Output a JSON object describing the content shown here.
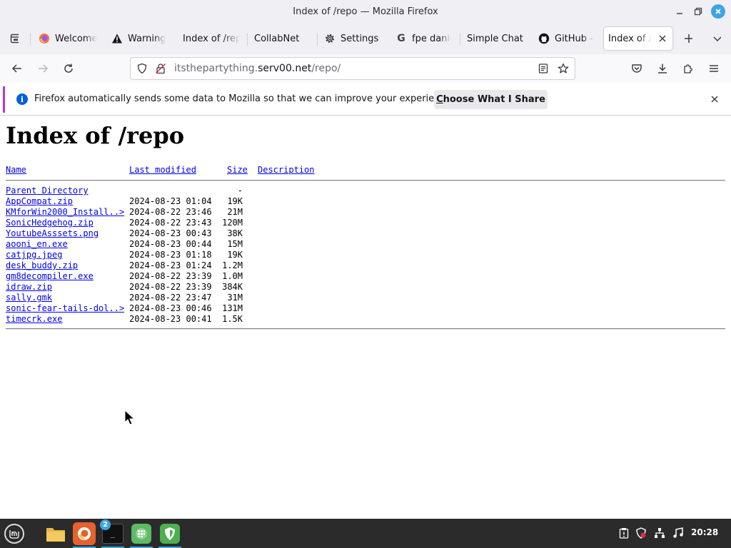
{
  "window": {
    "title": "Index of /repo — Mozilla Firefox"
  },
  "tabs": [
    {
      "label": "Welcome",
      "icon": "firefox-icon"
    },
    {
      "label": "Warning:",
      "icon": "warning-icon"
    },
    {
      "label": "Index of /rep",
      "icon": ""
    },
    {
      "label": "CollabNet",
      "icon": ""
    },
    {
      "label": "Settings",
      "icon": "gear-icon"
    },
    {
      "label": "fpe danie",
      "icon": "google-icon"
    },
    {
      "label": "Simple Chat",
      "icon": ""
    },
    {
      "label": "GitHub - y",
      "icon": "github-icon"
    },
    {
      "label": "Index of /r",
      "icon": "",
      "active": true
    }
  ],
  "navbar": {
    "url_prefix": "itsthepartything.",
    "url_host": "serv00.net",
    "url_path": "/repo/"
  },
  "notification": {
    "message": "Firefox automatically sends some data to Mozilla so that we can improve your experience.",
    "button_label": "Choose What I Share",
    "button_accesskey": "C",
    "button_rest": "hoose What I Share"
  },
  "page": {
    "heading": "Index of /repo",
    "columns": {
      "name": "Name",
      "last_modified": "Last modified",
      "size": "Size",
      "description": "Description"
    },
    "parent": {
      "name": "Parent Directory",
      "size": "-"
    },
    "files": [
      {
        "name": "AppCompat.zip",
        "date": "2024-08-23 01:04",
        "size": "19K"
      },
      {
        "name": "KMforWin2000_Install..>",
        "date": "2024-08-22 23:46",
        "size": "21M"
      },
      {
        "name": "SonicHedgehog.zip",
        "date": "2024-08-22 23:43",
        "size": "120M"
      },
      {
        "name": "YoutubeAsssets.png",
        "date": "2024-08-23 00:43",
        "size": "38K"
      },
      {
        "name": "aooni_en.exe",
        "date": "2024-08-23 00:44",
        "size": "15M"
      },
      {
        "name": "catjpg.jpeg",
        "date": "2024-08-23 01:18",
        "size": "19K"
      },
      {
        "name": "desk_buddy.zip",
        "date": "2024-08-23 01:24",
        "size": "1.2M"
      },
      {
        "name": "gm8decompiler.exe",
        "date": "2024-08-22 23:39",
        "size": "1.0M"
      },
      {
        "name": "idraw.zip",
        "date": "2024-08-22 23:39",
        "size": "384K"
      },
      {
        "name": "sally.gmk",
        "date": "2024-08-22 23:47",
        "size": "31M"
      },
      {
        "name": "sonic-fear-tails-dol..>",
        "date": "2024-08-23 00:46",
        "size": "131M"
      },
      {
        "name": "timecrk.exe",
        "date": "2024-08-23 00:41",
        "size": "1.5K"
      }
    ]
  },
  "taskbar": {
    "items": [
      "mint-menu-icon",
      "files-icon",
      "firefox-icon",
      "terminal-icon",
      "spreadsheet-icon",
      "vpn-shield-icon"
    ],
    "terminal_badge": "2",
    "clock": "20:28"
  },
  "colors": {
    "link": "#0000ee",
    "accent": "#3ea5e3",
    "notification_border": "#b833e1",
    "info_blue": "#0060df",
    "taskbar_bg": "#2b2b2b"
  }
}
